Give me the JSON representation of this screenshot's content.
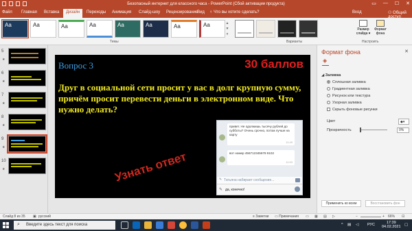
{
  "window": {
    "title": "Безопасный интернет для классного часа - PowerPoint (Сбой активации продукта)",
    "controls": {
      "ribbon_options": "▭",
      "minimize": "—",
      "maximize": "☐",
      "close": "✕"
    }
  },
  "tabs": [
    "Файл",
    "Главная",
    "Вставка",
    "Дизайн",
    "Переходы",
    "Анимация",
    "Слайд-шоу",
    "Рецензирование",
    "Вид"
  ],
  "active_tab": "Дизайн",
  "tell_me": "♀ Что вы хотите сделать?",
  "login": "Вход",
  "share": "⚇ Общий доступ",
  "ribbon": {
    "themes_label": "Темы",
    "variants_label": "Варианты",
    "customize_label": "Настроить",
    "theme_sample": "Aa",
    "slide_size": "Размер слайда ▾",
    "background_format": "Формат фона",
    "gallery_arrows": [
      "▲",
      "▼",
      "▾"
    ]
  },
  "slides": [
    {
      "num": "5",
      "star": "★"
    },
    {
      "num": "6",
      "star": "★"
    },
    {
      "num": "7",
      "star": "★"
    },
    {
      "num": "8",
      "star": "★"
    },
    {
      "num": "9",
      "star": "★"
    },
    {
      "num": "10",
      "star": "★"
    }
  ],
  "slide": {
    "question": "Вопрос 3",
    "score": "30 баллов",
    "text": "Друг в социальной сети просит у вас в долг крупную сумму, причём просит перевести деньги в электронном виде. Что нужно делать?",
    "answer_link": "Узнать ответ",
    "chat": {
      "msg1": "привет. Не одолжишь тысячу рублей до субботы? Очень срочно, потом лучше на карту",
      "time1": "11:49",
      "msg2": "вот номер 456712345678 9102",
      "time2": "11:53",
      "typing": "Татьяна набирает сообщение...",
      "input": "да, конечно!"
    }
  },
  "format_pane": {
    "title": "Формат фона",
    "close": "✕",
    "section": "◢ Заливка",
    "options": [
      "Сплошная заливка",
      "Градиентная заливка",
      "Рисунок или текстура",
      "Узорная заливка"
    ],
    "selected_option": 0,
    "hide_bg": "Скрыть фоновые рисунки",
    "color_label": "Цвет",
    "color_value": "▾",
    "transparency_label": "Прозрачность",
    "transparency_value": "0%",
    "apply_all": "Применить ко всем",
    "reset": "Восстановить фон"
  },
  "status": {
    "slide_info": "Слайд 8 из 35",
    "language": "русский",
    "notes": "≡ Заметки",
    "comments": "▭ Примечания",
    "zoom": "66%"
  },
  "taskbar": {
    "search_placeholder": "Введите здесь текст для поиска",
    "language": "РУС",
    "time": "17:39",
    "date": "04.02.2021"
  },
  "colors": {
    "accent": "#b7472a",
    "slide_bg": "#000000",
    "question_color": "#3ea0e4",
    "score_color": "#e02020",
    "question_text_color": "#f2ea1e"
  }
}
